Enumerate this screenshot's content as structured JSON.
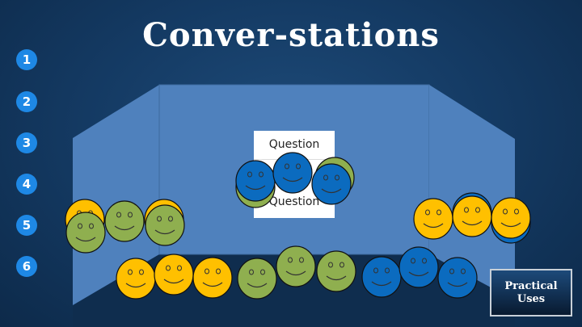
{
  "slide": {
    "title": "Conver-stations",
    "steps": [
      "1",
      "2",
      "3",
      "4",
      "5",
      "6"
    ],
    "question_top": "Question",
    "question_bottom": "Question",
    "practical_button": {
      "line1": "Practical",
      "line2": "Uses"
    }
  },
  "colors": {
    "background": "#143a63",
    "panel": "#4f81bd",
    "floor": "#0f2d4e",
    "step_badge": "#1e88e5",
    "face_yellow": "#ffc000",
    "face_green": "#8faf4f",
    "face_blue": "#0b6bbf"
  }
}
